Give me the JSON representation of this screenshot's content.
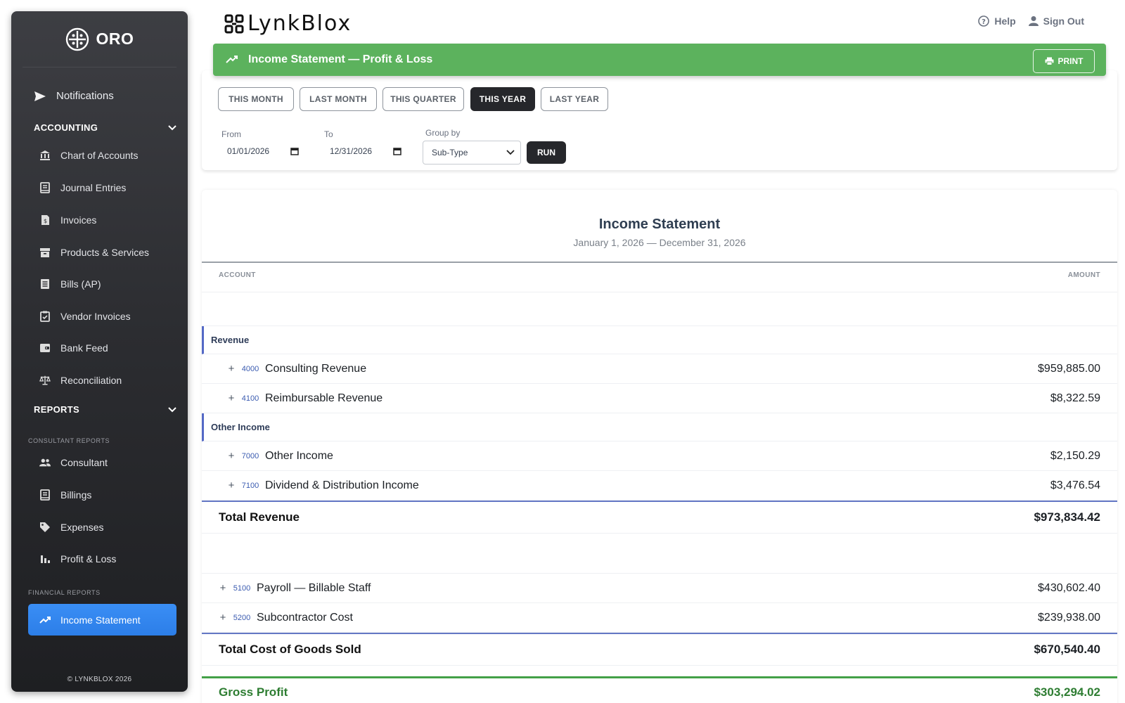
{
  "sidebar": {
    "brand": "ORO",
    "notifications": "Notifications",
    "accounting_label": "ACCOUNTING",
    "accounting_items": [
      "Chart of Accounts",
      "Journal Entries",
      "Invoices",
      "Products & Services",
      "Bills (AP)",
      "Vendor Invoices",
      "Bank Feed",
      "Reconciliation"
    ],
    "reports_label": "REPORTS",
    "consultant_reports_label": "CONSULTANT REPORTS",
    "consultant_items": [
      "Consultant",
      "Billings",
      "Expenses",
      "Profit & Loss"
    ],
    "financial_reports_label": "FINANCIAL REPORTS",
    "active_item": "Income Statement",
    "copyright": "© LYNKBLOX 2026"
  },
  "topbar": {
    "logo": "LynkBlox",
    "help": "Help",
    "sign_out": "Sign Out"
  },
  "header": {
    "title": "Income Statement — Profit & Loss",
    "print": "PRINT",
    "accent": "#5cb25d"
  },
  "controls": {
    "periods": [
      "THIS MONTH",
      "LAST MONTH",
      "THIS QUARTER",
      "THIS YEAR",
      "LAST YEAR"
    ],
    "active_period": "THIS YEAR",
    "from_label": "From",
    "from_value": "01/01/2026",
    "to_label": "To",
    "to_value": "12/31/2026",
    "group_label": "Group by",
    "group_value": "Sub-Type",
    "run": "RUN"
  },
  "report": {
    "title": "Income Statement",
    "subtitle": "January 1, 2026 — December 31, 2026",
    "col_account": "ACCOUNT",
    "col_amount": "AMOUNT",
    "revenue_group": "Revenue",
    "other_income_group": "Other Income",
    "rows": [
      {
        "code": "4000",
        "name": "Consulting Revenue",
        "amount": "$959,885.00"
      },
      {
        "code": "4100",
        "name": "Reimbursable Revenue",
        "amount": "$8,322.59"
      },
      {
        "code": "7000",
        "name": "Other Income",
        "amount": "$2,150.29"
      },
      {
        "code": "7100",
        "name": "Dividend & Distribution Income",
        "amount": "$3,476.54"
      },
      {
        "code": "5100",
        "name": "Payroll — Billable Staff",
        "amount": "$430,602.40"
      },
      {
        "code": "5200",
        "name": "Subcontractor Cost",
        "amount": "$239,938.00"
      }
    ],
    "total_revenue_label": "Total Revenue",
    "total_revenue": "$973,834.42",
    "total_cogs_label": "Total Cost of Goods Sold",
    "total_cogs": "$670,540.40",
    "gross_profit_label": "Gross Profit",
    "gross_profit": "$303,294.02"
  }
}
